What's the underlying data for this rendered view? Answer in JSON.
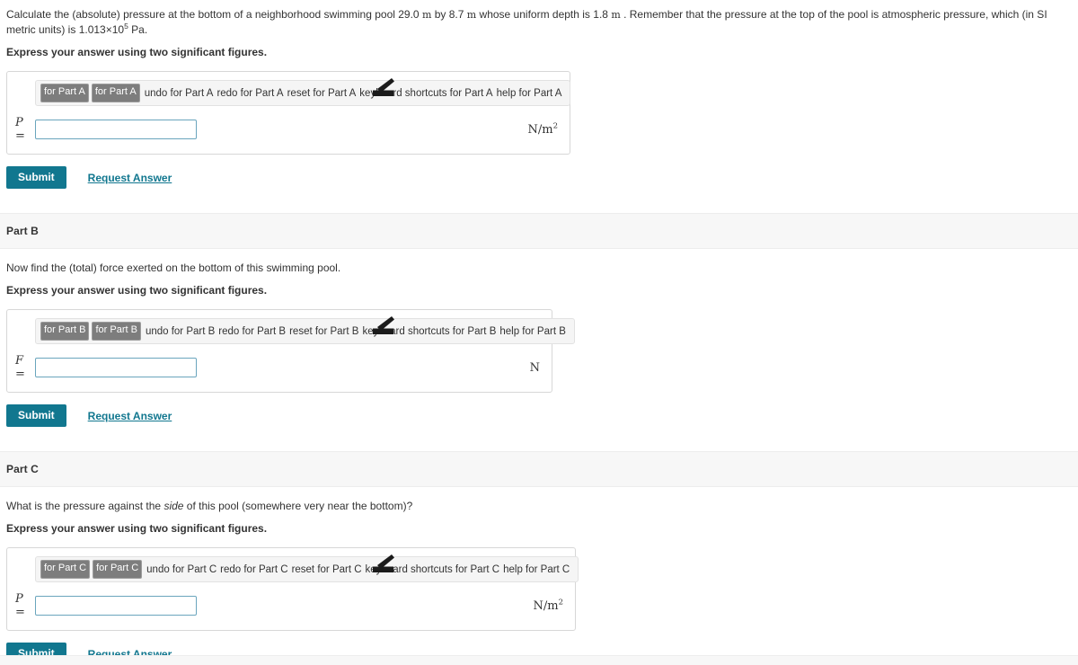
{
  "problem": {
    "statement_pre": "Calculate the (absolute) pressure at the bottom of a neighborhood swimming pool ",
    "dim1": "29.0",
    "dim1_unit": "m",
    "between1": " by ",
    "dim2": "8.7",
    "dim2_unit": "m",
    "between2": " whose uniform depth is ",
    "depth": "1.8",
    "depth_unit": "m",
    "statement_mid": " .  Remember that the pressure at the top of the pool is atmospheric pressure, which (in SI metric units) is ",
    "atm_mantissa": "1.013×10",
    "atm_exponent": "5",
    "atm_unit": "Pa."
  },
  "sigfig_instruction": "Express your answer using two significant figures.",
  "actions": {
    "submit_label": "Submit",
    "request_answer_label": "Request Answer"
  },
  "parts": [
    {
      "id": "a",
      "header": "",
      "prompt": "",
      "variable": "P",
      "equals": "=",
      "value": "",
      "placeholder": "",
      "unit_base": "N/m",
      "unit_exp": "2",
      "toolbar": {
        "template_button_1": "for Part A",
        "template_button_2": "for Part A",
        "undo": "undo for Part A",
        "redo": "redo for Part A",
        "reset": "reset for Part A",
        "keyboard_shortcuts": "keyboard shortcuts for Part A",
        "help": "help for Part A"
      }
    },
    {
      "id": "b",
      "header": "Part B",
      "prompt": "Now find the (total) force exerted on the bottom of this swimming pool.",
      "variable": "F",
      "equals": "=",
      "value": "",
      "placeholder": "",
      "unit_base": "N",
      "unit_exp": "",
      "toolbar": {
        "template_button_1": "for Part B",
        "template_button_2": "for Part B",
        "undo": "undo for Part B",
        "redo": "redo for Part B",
        "reset": "reset for Part B",
        "keyboard_shortcuts": "keyboard shortcuts for Part B",
        "help": "help for Part B"
      }
    },
    {
      "id": "c",
      "header": "Part C",
      "prompt_pre": "What is the pressure against the ",
      "prompt_italic": "side",
      "prompt_post": " of this pool (somewhere very near the bottom)?",
      "variable": "P",
      "equals": "=",
      "value": "",
      "placeholder": "",
      "unit_base": "N/m",
      "unit_exp": "2",
      "toolbar": {
        "template_button_1": "for Part C",
        "template_button_2": "for Part C",
        "undo": "undo for Part C",
        "redo": "redo for Part C",
        "reset": "reset for Part C",
        "keyboard_shortcuts": "keyboard shortcuts for Part C",
        "help": "help for Part C"
      }
    }
  ],
  "colors": {
    "accent": "#11778f",
    "input_border": "#6aa5bd",
    "band": "#f7f7f7",
    "template_button": "#7d7d7d"
  }
}
